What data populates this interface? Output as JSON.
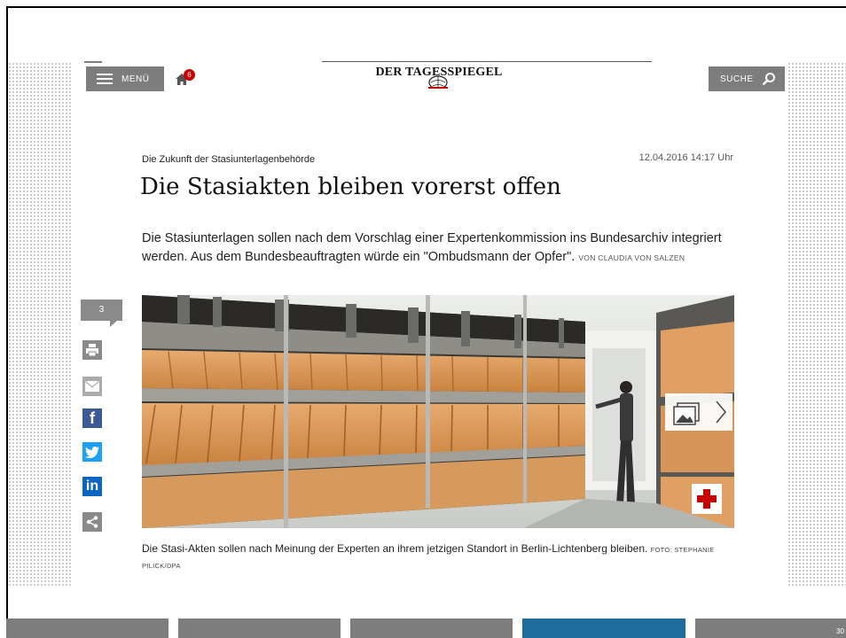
{
  "header": {
    "menu_label": "MENÜ",
    "home_badge_count": "6",
    "logo_text": "DER TAGESSPIEGEL",
    "search_label": "SUCHE"
  },
  "article": {
    "kicker": "Die Zukunft der Stasiunterlagenbehörde",
    "timestamp": "12.04.2016 14:17 Uhr",
    "headline": "Die Stasiakten bleiben vorerst offen",
    "lead": "Die Stasiunterlagen sollen nach dem Vorschlag einer Expertenkommission ins Bundesarchiv integriert werden. Aus dem Bundesbeauftragten würde ein \"Ombudsmann der Opfer\".",
    "author": "VON CLAUDIA VON SALZEN",
    "caption": "Die Stasi-Akten sollen nach Meinung der Experten an ihrem jetzigen Standort in Berlin-Lichtenberg bleiben.",
    "photo_credit": "FOTO: STEPHANIE PILICK/DPA"
  },
  "share": {
    "comment_count": "3",
    "icons": [
      "print-icon",
      "mail-icon",
      "facebook-icon",
      "twitter-icon",
      "linkedin-icon",
      "share-icon"
    ]
  },
  "footer": {
    "segment_colors": [
      "#7d7d7d",
      "#7d7d7d",
      "#7d7d7d",
      "#1f6d9e",
      "#7d7d7d"
    ],
    "page_number": "30"
  },
  "colors": {
    "accent_red": "#c90000",
    "button_gray": "#7d7d7d",
    "facebook": "#3b5998",
    "twitter": "#1da1f2",
    "linkedin": "#0a66c2"
  }
}
